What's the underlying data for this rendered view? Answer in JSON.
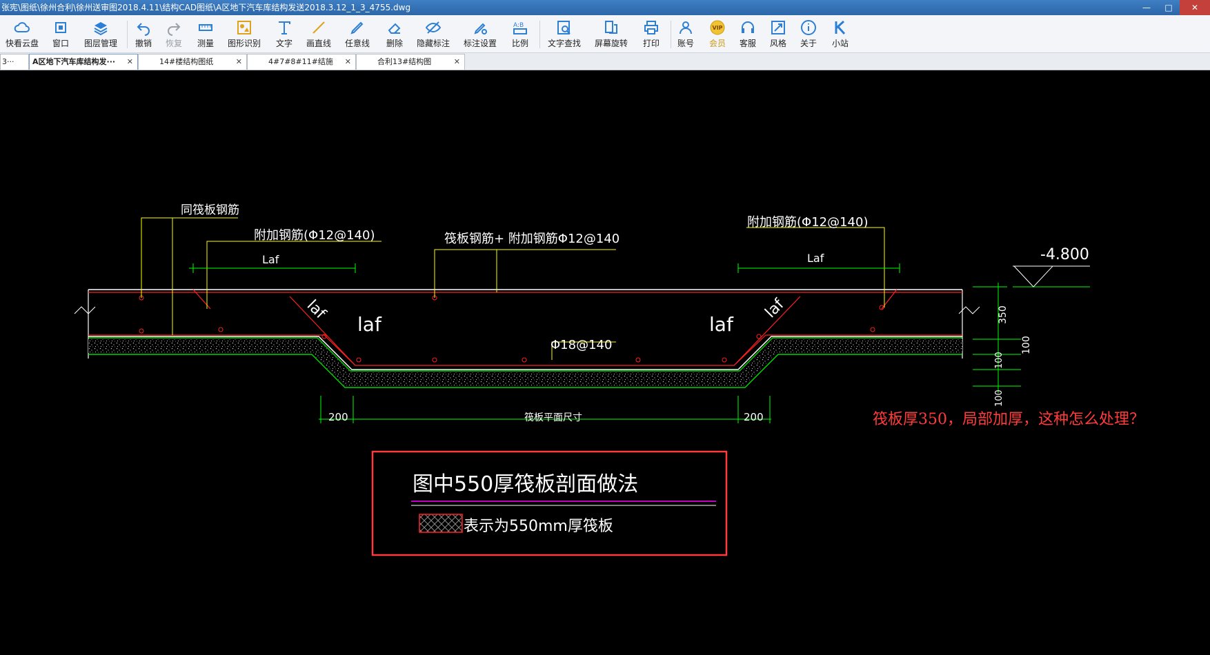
{
  "window": {
    "title": "张宪\\图纸\\徐州合利\\徐州送审图2018.4.11\\结构CAD图纸\\A区地下汽车库结构发送2018.3.12_1_3_4755.dwg",
    "minimize": "—",
    "maximize": "□",
    "close": "✕"
  },
  "toolbar": {
    "items": [
      {
        "label": "快看云盘",
        "icon": "cloud-icon"
      },
      {
        "label": "窗口",
        "icon": "window-icon"
      },
      {
        "label": "图层管理",
        "icon": "layers-icon"
      },
      {
        "label": "撤销",
        "icon": "undo-icon"
      },
      {
        "label": "恢复",
        "icon": "redo-icon"
      },
      {
        "label": "测量",
        "icon": "ruler-icon"
      },
      {
        "label": "图形识别",
        "icon": "shape-recognize-icon"
      },
      {
        "label": "文字",
        "icon": "text-icon"
      },
      {
        "label": "画直线",
        "icon": "line-icon"
      },
      {
        "label": "任意线",
        "icon": "pen-icon"
      },
      {
        "label": "删除",
        "icon": "eraser-icon"
      },
      {
        "label": "隐藏标注",
        "icon": "eye-hide-icon"
      },
      {
        "label": "标注设置",
        "icon": "annotation-settings-icon"
      },
      {
        "label": "比例",
        "icon": "scale-icon"
      },
      {
        "label": "文字查找",
        "icon": "text-search-icon"
      },
      {
        "label": "屏幕旋转",
        "icon": "rotate-icon"
      },
      {
        "label": "打印",
        "icon": "printer-icon"
      },
      {
        "label": "账号",
        "icon": "user-icon"
      },
      {
        "label": "会员",
        "icon": "vip-icon"
      },
      {
        "label": "客服",
        "icon": "headset-icon"
      },
      {
        "label": "风格",
        "icon": "style-icon"
      },
      {
        "label": "关于",
        "icon": "info-icon"
      },
      {
        "label": "小站",
        "icon": "k-logo-icon"
      }
    ]
  },
  "tabs": [
    {
      "label": "3···"
    },
    {
      "label": "A区地下汽车库结构发···"
    },
    {
      "label": "14#楼结构图纸"
    },
    {
      "label": "4#7#8#11#结施"
    },
    {
      "label": "合利13#结构图"
    }
  ],
  "tab_close": "✕",
  "drawing": {
    "label_same_rebar": "同筏板钢筋",
    "label_add_rebar_left": "附加钢筋(Φ12@140)",
    "label_raft_rebar": "筏板钢筋+ 附加钢筋Φ12@140",
    "label_add_rebar_right": "附加钢筋(Φ12@140)",
    "laf": "Laf",
    "laf_lower": "laf",
    "elev": "-4.800",
    "bottom_bar": "Φ18@140",
    "dim_350": "350",
    "dim_100": "100",
    "dim_200": "200",
    "dim_raft_plan": "筏板平面尺寸",
    "legend_title": "图中550厚筏板剖面做法",
    "legend_text": "表示为550mm厚筏板",
    "colors": {
      "concrete": "#ffffff",
      "rebar": "#ff2020",
      "dim": "#00ff00",
      "leader": "#ffff00",
      "hatch": "#aaaaaa",
      "legend_border": "#ff3b3b",
      "legend_line": "#ff00ff"
    }
  },
  "question": "筏板厚350，局部加厚，这种怎么处理？"
}
